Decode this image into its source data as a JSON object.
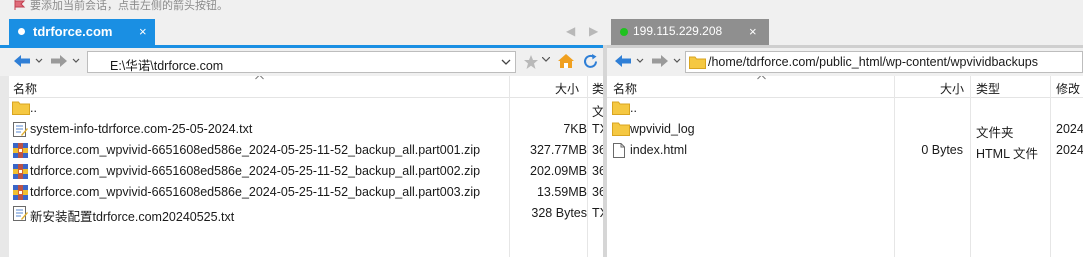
{
  "hint": {
    "text": "要添加当前会话，点击左侧的箭头按钮。"
  },
  "tabs": {
    "local": {
      "label": "tdrforce.com",
      "close": "×"
    },
    "remote": {
      "label": "199.115.229.208",
      "close": "×"
    },
    "nav_prev": "◀",
    "nav_next": "▶"
  },
  "local": {
    "path": "E:\\华诺\\tdrforce.com",
    "columns": {
      "name": "名称",
      "size": "大小",
      "type": "类"
    },
    "rows": [
      {
        "name": "..",
        "size": "",
        "type": "文",
        "icon": "folder-icon"
      },
      {
        "name": "system-info-tdrforce.com-25-05-2024.txt",
        "size": "7KB",
        "type": "TX",
        "icon": "text-file-icon"
      },
      {
        "name": "tdrforce.com_wpvivid-6651608ed586e_2024-05-25-11-52_backup_all.part001.zip",
        "size": "327.77MB",
        "type": "36",
        "icon": "zip-icon"
      },
      {
        "name": "tdrforce.com_wpvivid-6651608ed586e_2024-05-25-11-52_backup_all.part002.zip",
        "size": "202.09MB",
        "type": "36",
        "icon": "zip-icon"
      },
      {
        "name": "tdrforce.com_wpvivid-6651608ed586e_2024-05-25-11-52_backup_all.part003.zip",
        "size": "13.59MB",
        "type": "36",
        "icon": "zip-icon"
      },
      {
        "name": "新安装配置tdrforce.com20240525.txt",
        "size": "328 Bytes",
        "type": "TX",
        "icon": "text-file-icon"
      }
    ]
  },
  "remote": {
    "path": "/home/tdrforce.com/public_html/wp-content/wpvividbackups",
    "columns": {
      "name": "名称",
      "size": "大小",
      "type": "类型",
      "modified": "修改"
    },
    "rows": [
      {
        "name": "..",
        "size": "",
        "type": "",
        "modified": "",
        "icon": "folder-icon"
      },
      {
        "name": "wpvivid_log",
        "size": "",
        "type": "文件夹",
        "modified": "2024",
        "icon": "folder-icon"
      },
      {
        "name": "index.html",
        "size": "0 Bytes",
        "type": "HTML 文件",
        "modified": "2024",
        "icon": "html-file-icon"
      }
    ]
  },
  "colors": {
    "accent": "#1a8fe3",
    "folder": "#f5c842",
    "online": "#1fc21f"
  }
}
